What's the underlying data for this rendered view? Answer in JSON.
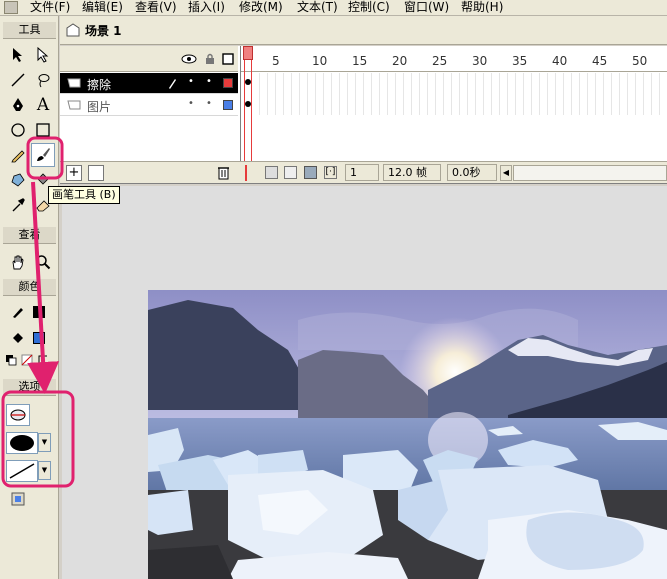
{
  "menubar": {
    "items": [
      "文件(F)",
      "编辑(E)",
      "查看(V)",
      "插入(I)",
      "修改(M)",
      "文本(T)",
      "控制(C)",
      "窗口(W)",
      "帮助(H)"
    ]
  },
  "tools_panel": {
    "title": "工具",
    "view_title": "查看",
    "colors_title": "颜色",
    "options_title": "选项",
    "stroke_color": "#000000",
    "fill_color": "#2f6fd6"
  },
  "scene": {
    "label": "场景 1"
  },
  "timeline": {
    "layers": [
      {
        "name": "擦除",
        "active": true,
        "outline_color": "#e63b3b"
      },
      {
        "name": "图片",
        "active": false,
        "outline_color": "#4a7fe6"
      }
    ],
    "ruler_ticks": [
      "5",
      "10",
      "15",
      "20",
      "25",
      "30",
      "35",
      "40",
      "45",
      "50"
    ],
    "status": {
      "current_frame": "1",
      "frame_rate": "12.0 帧",
      "elapsed": "0.0秒"
    }
  },
  "tooltip": {
    "text": "画笔工具 (B)"
  },
  "annotation_color": "#e0216e"
}
